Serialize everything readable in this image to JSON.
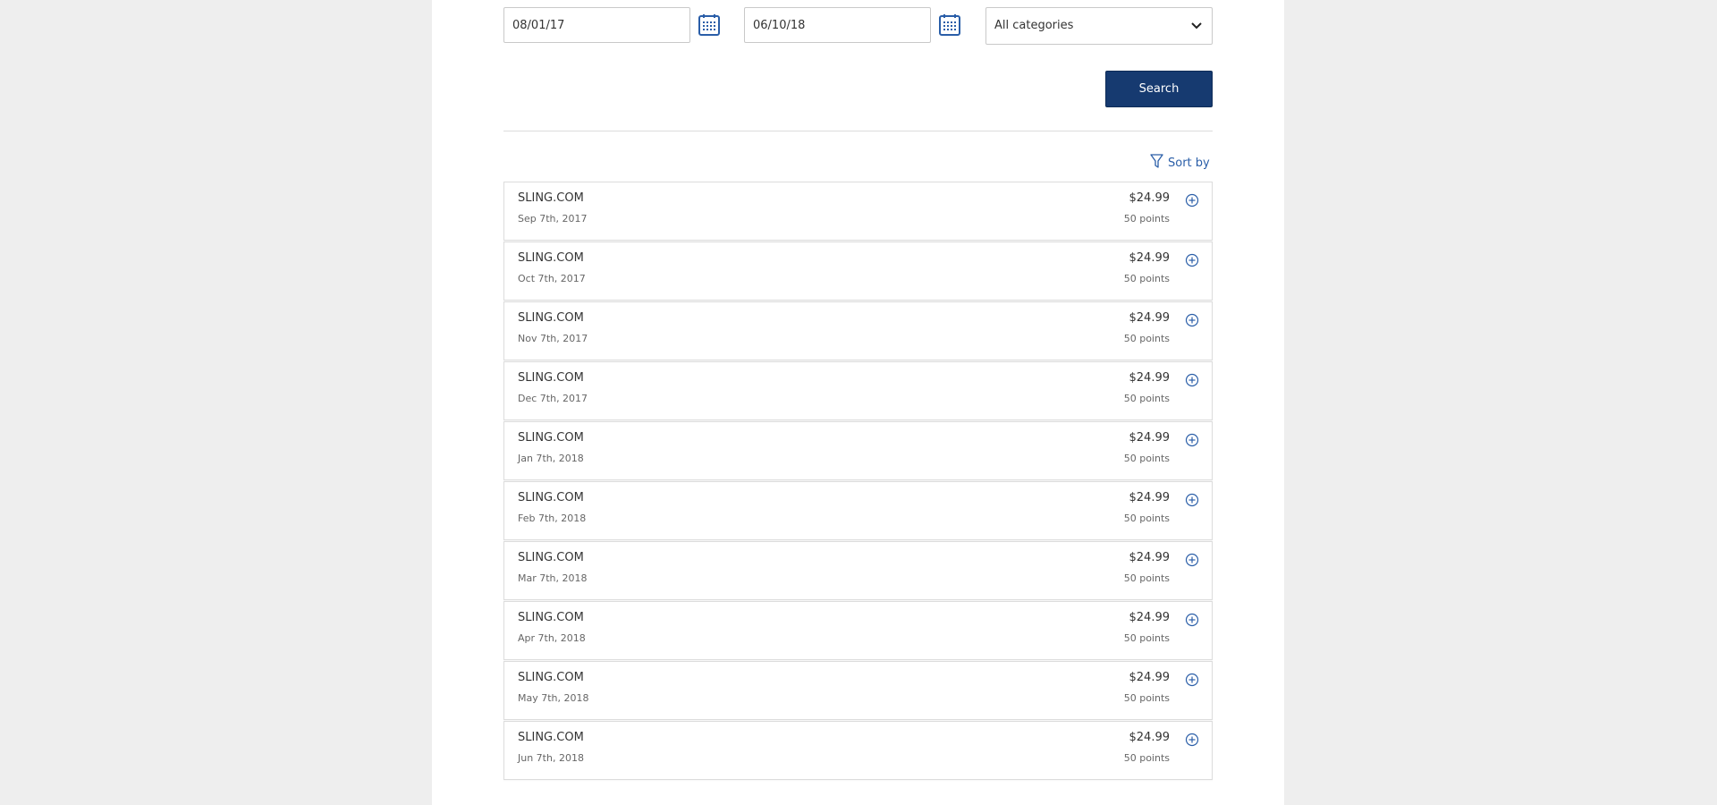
{
  "filters": {
    "from_value": "08/01/17",
    "to_value": "06/10/18",
    "category_value": "All categories",
    "search_label": "Search"
  },
  "sort": {
    "label": "Sort by"
  },
  "colors": {
    "accent": "#2a5ea8",
    "button": "#163a70"
  },
  "transactions": [
    {
      "merchant": "SLING.COM",
      "date": "Sep 7th, 2017",
      "amount": "$24.99",
      "points": "50 points"
    },
    {
      "merchant": "SLING.COM",
      "date": "Oct 7th, 2017",
      "amount": "$24.99",
      "points": "50 points"
    },
    {
      "merchant": "SLING.COM",
      "date": "Nov 7th, 2017",
      "amount": "$24.99",
      "points": "50 points"
    },
    {
      "merchant": "SLING.COM",
      "date": "Dec 7th, 2017",
      "amount": "$24.99",
      "points": "50 points"
    },
    {
      "merchant": "SLING.COM",
      "date": "Jan 7th, 2018",
      "amount": "$24.99",
      "points": "50 points"
    },
    {
      "merchant": "SLING.COM",
      "date": "Feb 7th, 2018",
      "amount": "$24.99",
      "points": "50 points"
    },
    {
      "merchant": "SLING.COM",
      "date": "Mar 7th, 2018",
      "amount": "$24.99",
      "points": "50 points"
    },
    {
      "merchant": "SLING.COM",
      "date": "Apr 7th, 2018",
      "amount": "$24.99",
      "points": "50 points"
    },
    {
      "merchant": "SLING.COM",
      "date": "May 7th, 2018",
      "amount": "$24.99",
      "points": "50 points"
    },
    {
      "merchant": "SLING.COM",
      "date": "Jun 7th, 2018",
      "amount": "$24.99",
      "points": "50 points"
    }
  ]
}
